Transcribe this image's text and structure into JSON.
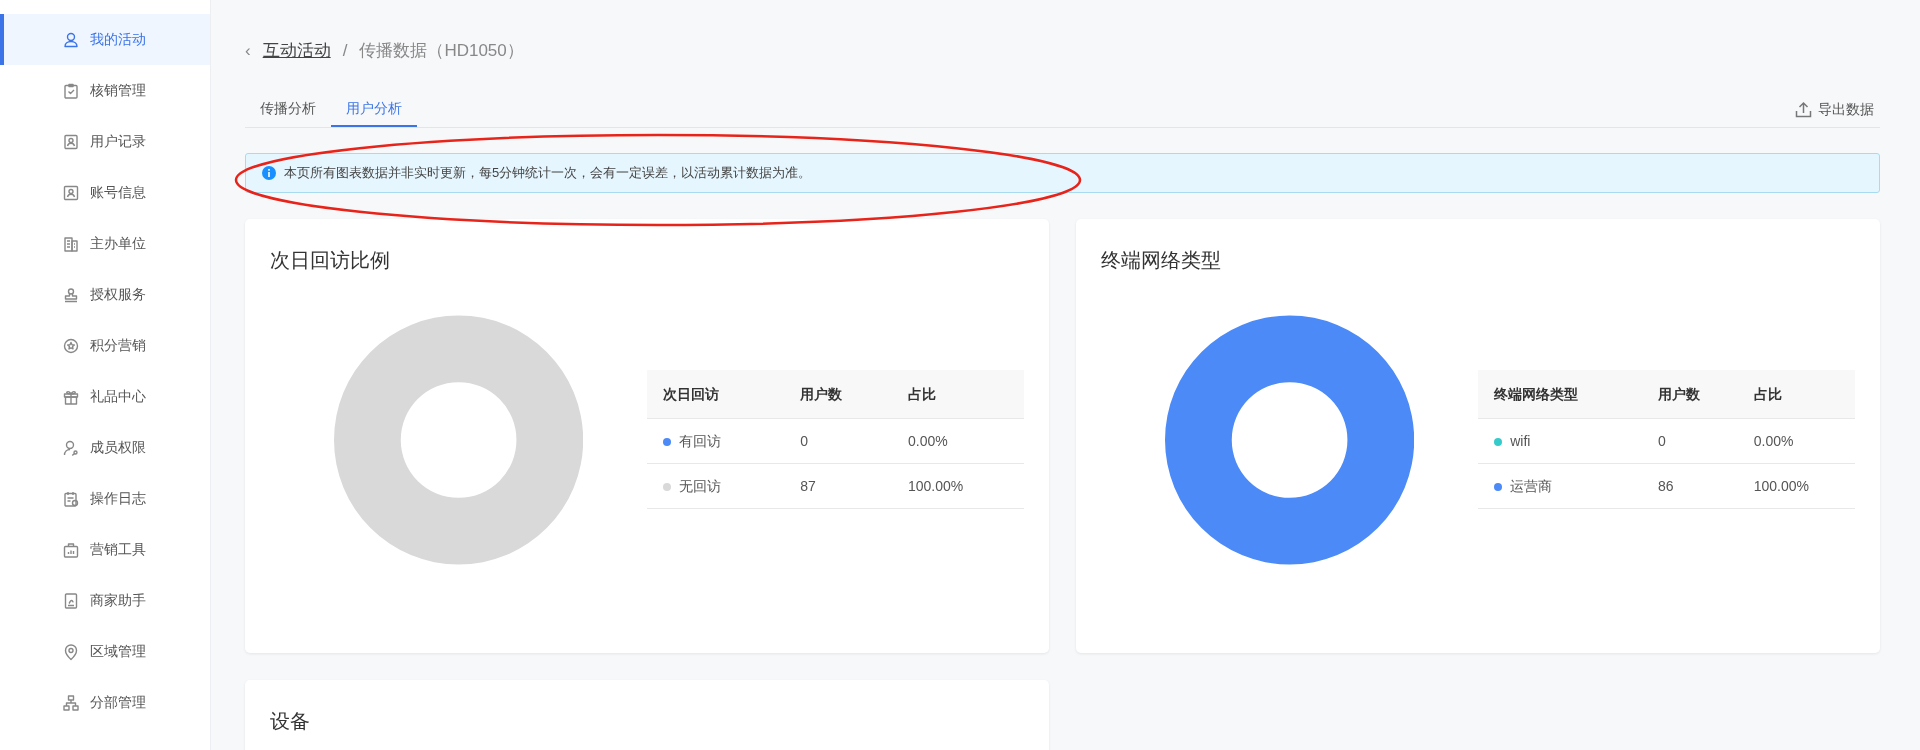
{
  "sidebar": {
    "items": [
      {
        "label": "我的活动",
        "selected": true
      },
      {
        "label": "核销管理",
        "selected": false
      },
      {
        "label": "用户记录",
        "selected": false
      },
      {
        "label": "账号信息",
        "selected": false
      },
      {
        "label": "主办单位",
        "selected": false
      },
      {
        "label": "授权服务",
        "selected": false
      },
      {
        "label": "积分营销",
        "selected": false
      },
      {
        "label": "礼品中心",
        "selected": false
      },
      {
        "label": "成员权限",
        "selected": false
      },
      {
        "label": "操作日志",
        "selected": false
      },
      {
        "label": "营销工具",
        "selected": false
      },
      {
        "label": "商家助手",
        "selected": false
      },
      {
        "label": "区域管理",
        "selected": false
      },
      {
        "label": "分部管理",
        "selected": false
      }
    ]
  },
  "breadcrumb": {
    "back": "‹",
    "parent": "互动活动",
    "separator": "/",
    "current": "传播数据（HD1050）"
  },
  "tabs": [
    {
      "label": "传播分析",
      "selected": false
    },
    {
      "label": "用户分析",
      "selected": true
    }
  ],
  "export_button": "导出数据",
  "notice": "本页所有图表数据并非实时更新，每5分钟统计一次，会有一定误差，以活动累计数据为准。",
  "cards": [
    {
      "title": "次日回访比例",
      "columns": [
        "次日回访",
        "用户数",
        "占比"
      ],
      "rows": [
        {
          "label": "有回访",
          "color": "#4b8af7",
          "count": "0",
          "share": "0.00%"
        },
        {
          "label": "无回访",
          "color": "#d9d9d9",
          "count": "87",
          "share": "100.00%"
        }
      ]
    },
    {
      "title": "终端网络类型",
      "columns": [
        "终端网络类型",
        "用户数",
        "占比"
      ],
      "rows": [
        {
          "label": "wifi",
          "color": "#36cbcb",
          "count": "0",
          "share": "0.00%"
        },
        {
          "label": "运营商",
          "color": "#4b8af7",
          "count": "86",
          "share": "100.00%"
        }
      ]
    },
    {
      "title": "设备"
    }
  ]
}
